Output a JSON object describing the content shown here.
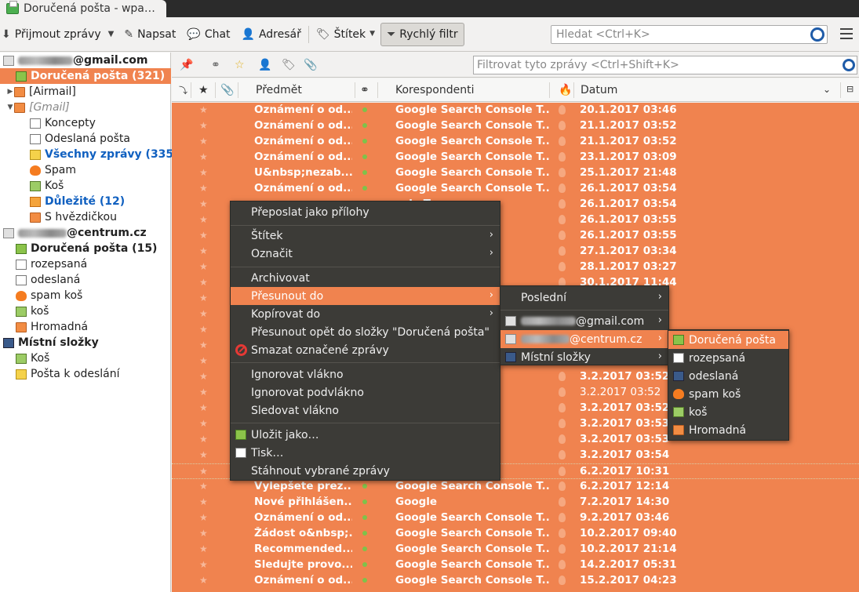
{
  "window": {
    "tab_title": "Doručená pošta - wpa…"
  },
  "toolbar": {
    "get_mail": "Přijmout zprávy",
    "write": "Napsat",
    "chat": "Chat",
    "address_book": "Adresář",
    "tag": "Štítek",
    "quick_filter": "Rychlý filtr",
    "search_placeholder": "Hledat <Ctrl+K>"
  },
  "folders": {
    "account1": "@gmail.com",
    "inbox1": "Doručená pošta (321)",
    "airmail": "[Airmail]",
    "gmail": "[Gmail]",
    "drafts": "Koncepty",
    "sent": "Odeslaná pošta",
    "allmail": "Všechny zprávy (335)",
    "spam": "Spam",
    "trash": "Koš",
    "important": "Důležité (12)",
    "starred": "S hvězdičkou",
    "account2": "@centrum.cz",
    "inbox2": "Doručená pošta (15)",
    "rozepsana": "rozepsaná",
    "odeslana": "odeslaná",
    "spamkos": "spam koš",
    "kos": "koš",
    "hromadna": "Hromadná",
    "local": "Místní složky",
    "local_trash": "Koš",
    "outbox": "Pošta k odeslání"
  },
  "filterbar": {
    "placeholder": "Filtrovat tyto zprávy <Ctrl+Shift+K>"
  },
  "columns": {
    "subject": "Předmět",
    "correspondents": "Korespondenti",
    "date": "Datum"
  },
  "messages": [
    {
      "subject": "Oznámení o od...",
      "from": "Google Search Console T...",
      "date": "20.1.2017 03:46"
    },
    {
      "subject": "Oznámení o od...",
      "from": "Google Search Console T...",
      "date": "21.1.2017 03:52"
    },
    {
      "subject": "Oznámení o od...",
      "from": "Google Search Console T...",
      "date": "21.1.2017 03:52"
    },
    {
      "subject": "Oznámení o od...",
      "from": "Google Search Console T...",
      "date": "23.1.2017 03:09"
    },
    {
      "subject": "U&nbsp;nezab...",
      "from": "Google Search Console T...",
      "date": "25.1.2017 21:48"
    },
    {
      "subject": "Oznámení o od...",
      "from": "Google Search Console T...",
      "date": "26.1.2017 03:54"
    },
    {
      "subject": "",
      "from": "sole T...",
      "date": "26.1.2017 03:54"
    },
    {
      "subject": "",
      "from": "sole T...",
      "date": "26.1.2017 03:55"
    },
    {
      "subject": "",
      "from": "sole T...",
      "date": "26.1.2017 03:55"
    },
    {
      "subject": "",
      "from": "sole T...",
      "date": "27.1.2017 03:34"
    },
    {
      "subject": "",
      "from": "sole T...",
      "date": "28.1.2017 03:27"
    },
    {
      "subject": "",
      "from": "sole T...",
      "date": "30.1.2017 11:44"
    },
    {
      "subject": "",
      "from": "",
      "date": ""
    },
    {
      "subject": "",
      "from": "",
      "date": ""
    },
    {
      "subject": "",
      "from": "",
      "date": ""
    },
    {
      "subject": "",
      "from": "",
      "date": ""
    },
    {
      "subject": "",
      "from": "",
      "date": ""
    },
    {
      "subject": "",
      "from": "sole T...",
      "date": "3.2.2017 03:52"
    },
    {
      "subject": "",
      "from": "ole Team",
      "date": "3.2.2017 03:52"
    },
    {
      "subject": "",
      "from": "sole T...",
      "date": "3.2.2017 03:52"
    },
    {
      "subject": "",
      "from": "sole T...",
      "date": "3.2.2017 03:53"
    },
    {
      "subject": "",
      "from": "sole T...",
      "date": "3.2.2017 03:53"
    },
    {
      "subject": "",
      "from": "sole T...",
      "date": "3.2.2017 03:54"
    },
    {
      "subject": "",
      "from": "sole T...",
      "date": "6.2.2017 10:31"
    },
    {
      "subject": "Vylepšete prez...",
      "from": "Google Search Console T...",
      "date": "6.2.2017 12:14"
    },
    {
      "subject": "Nové přihlášen...",
      "from": "Google",
      "date": "7.2.2017 14:30"
    },
    {
      "subject": "Oznámení o od...",
      "from": "Google Search Console T...",
      "date": "9.2.2017 03:46"
    },
    {
      "subject": "Žádost o&nbsp;...",
      "from": "Google Search Console T...",
      "date": "10.2.2017 09:40"
    },
    {
      "subject": "Recommended...",
      "from": "Google Search Console T...",
      "date": "10.2.2017 21:14"
    },
    {
      "subject": "Sledujte provo...",
      "from": "Google Search Console T...",
      "date": "14.2.2017 05:31"
    },
    {
      "subject": "Oznámení o od...",
      "from": "Google Search Console T...",
      "date": "15.2.2017 04:23"
    }
  ],
  "context_menu": {
    "forward_attach": "Přeposlat jako přílohy",
    "tag": "Štítek",
    "mark": "Označit",
    "archive": "Archivovat",
    "move_to": "Přesunout do",
    "copy_to": "Kopírovat do",
    "move_again": "Přesunout opět do složky \"Doručená pošta\"",
    "delete": "Smazat označené zprávy",
    "ignore_thread": "Ignorovat vlákno",
    "ignore_subthread": "Ignorovat podvlákno",
    "watch_thread": "Sledovat vlákno",
    "save_as": "Uložit jako…",
    "print": "Tisk…",
    "download": "Stáhnout vybrané zprávy"
  },
  "submenu1": {
    "recent": "Poslední",
    "gmail": "@gmail.com",
    "centrum": "@centrum.cz",
    "local": "Místní složky"
  },
  "submenu2": {
    "inbox": "Doručená pošta",
    "rozepsana": "rozepsaná",
    "odeslana": "odeslaná",
    "spamkos": "spam koš",
    "kos": "koš",
    "hromadna": "Hromadná"
  }
}
